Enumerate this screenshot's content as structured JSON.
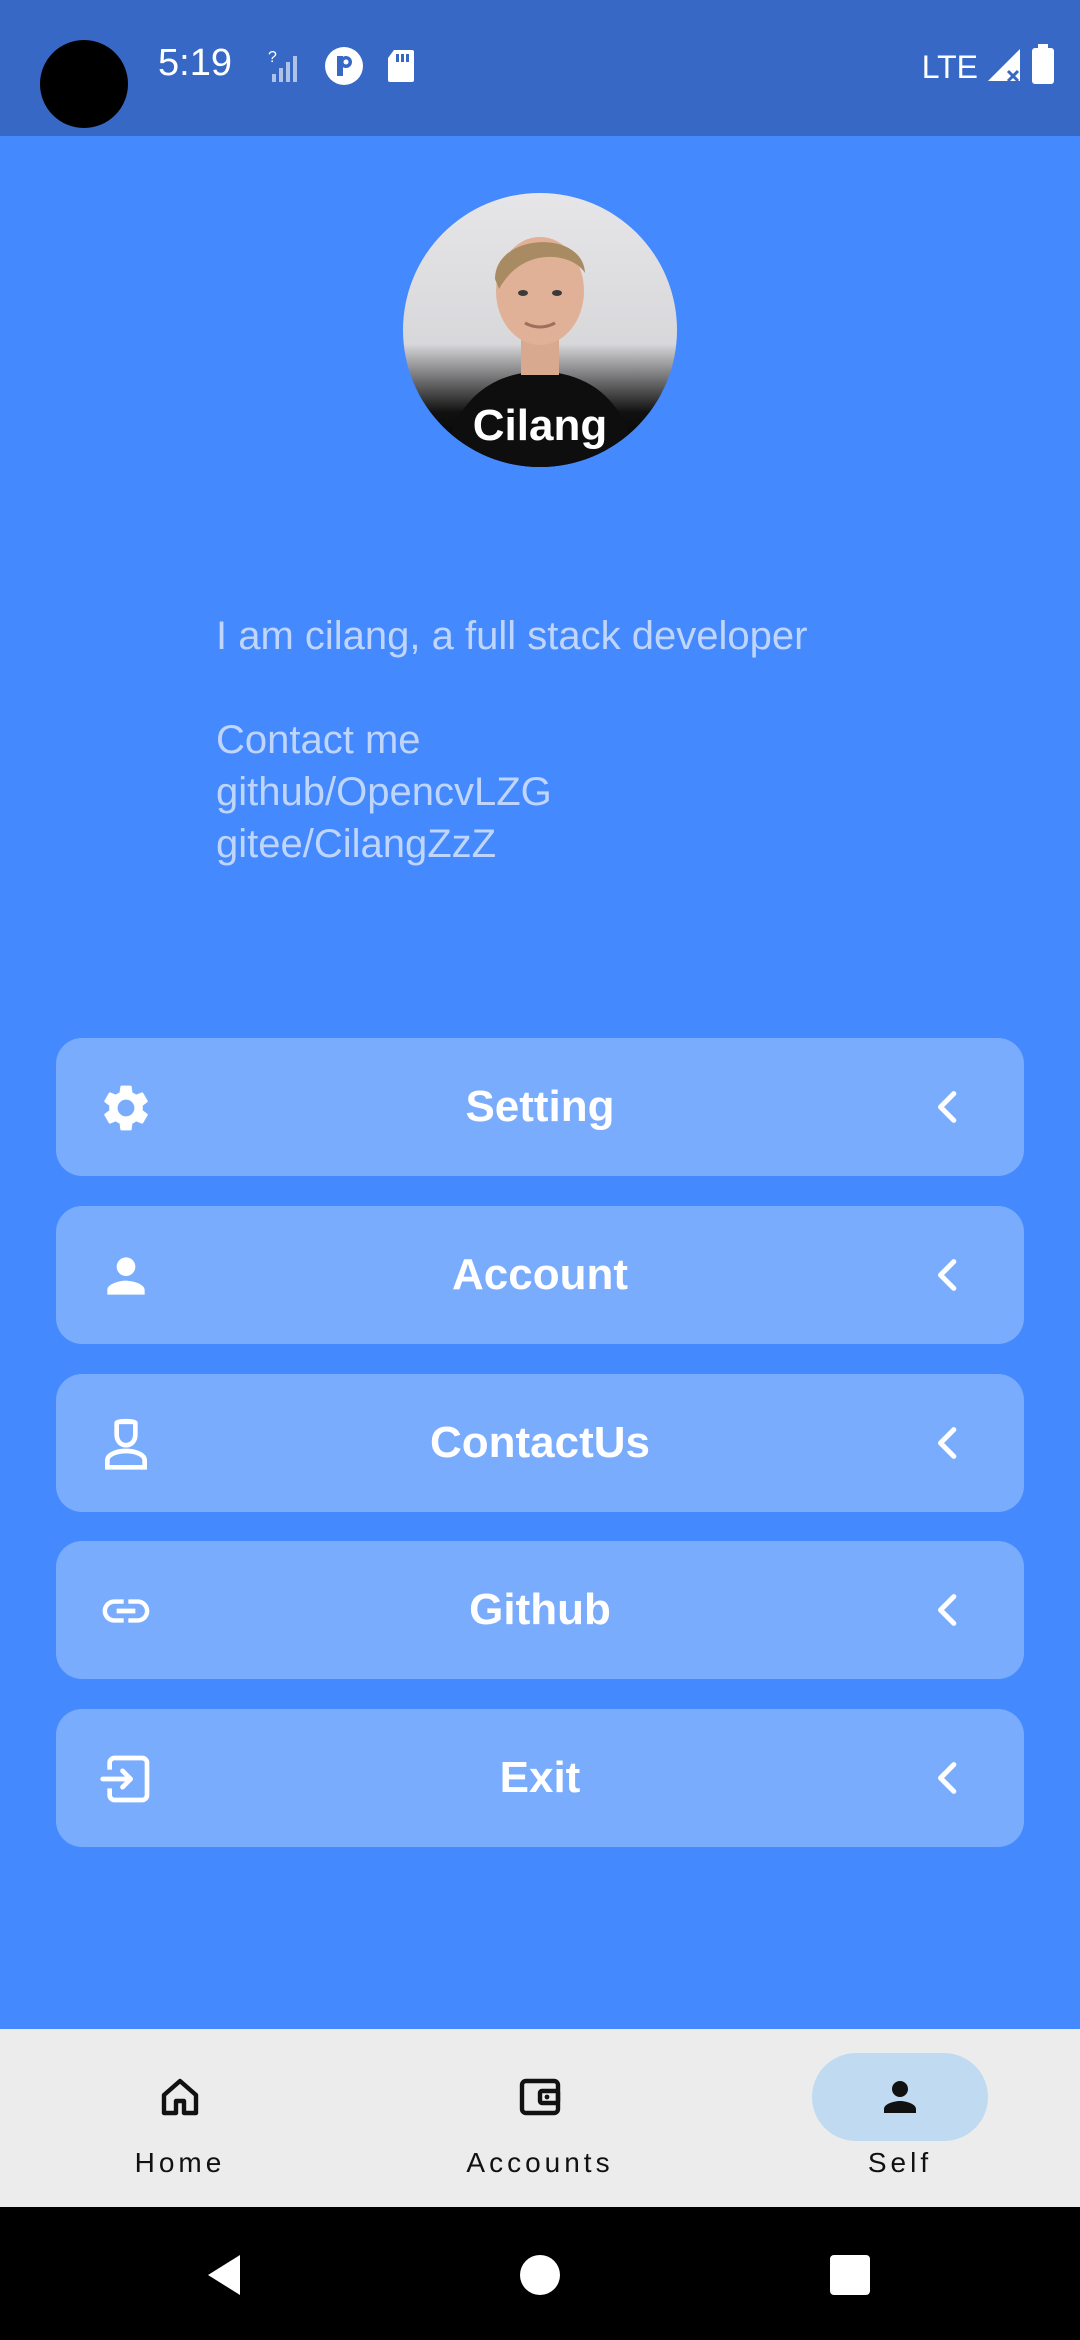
{
  "status_bar": {
    "time": "5:19",
    "network": "LTE",
    "icons": [
      "signal-unknown-icon",
      "app-badge-icon",
      "sd-card-icon",
      "cell-signal-icon",
      "battery-icon"
    ]
  },
  "profile": {
    "name": "Cilang",
    "bio": {
      "line1": "I am cilang, a full stack developer",
      "contact_heading": "Contact me",
      "github": "github/OpencvLZG",
      "gitee": "gitee/CilangZzZ"
    }
  },
  "menu": [
    {
      "label": "Setting",
      "icon": "gear-icon"
    },
    {
      "label": "Account",
      "icon": "person-icon"
    },
    {
      "label": "ContactUs",
      "icon": "contact-support-icon"
    },
    {
      "label": "Github",
      "icon": "link-icon"
    },
    {
      "label": "Exit",
      "icon": "exit-icon"
    }
  ],
  "bottom_nav": {
    "items": [
      {
        "label": "Home",
        "icon": "home-icon"
      },
      {
        "label": "Accounts",
        "icon": "wallet-icon"
      },
      {
        "label": "Self",
        "icon": "person-icon"
      }
    ],
    "active": "Self"
  },
  "colors": {
    "background": "#4489FD",
    "status_bar": "#3768C6",
    "card": "#7AACFD",
    "bio_text": "#BFD5FC",
    "nav_bar": "#ECECEC",
    "nav_active_pill": "#C0DBF1"
  }
}
